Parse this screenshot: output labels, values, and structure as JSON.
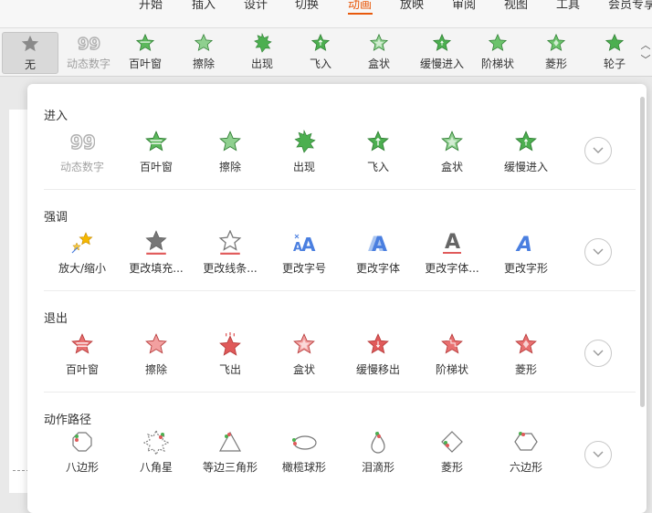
{
  "ribbon": {
    "tabs": [
      {
        "label": "开始"
      },
      {
        "label": "插入"
      },
      {
        "label": "设计"
      },
      {
        "label": "切换"
      },
      {
        "label": "动画"
      },
      {
        "label": "放映"
      },
      {
        "label": "审阅"
      },
      {
        "label": "视图"
      },
      {
        "label": "工具"
      },
      {
        "label": "会员专享"
      }
    ],
    "active_tab": "动画"
  },
  "strip": {
    "items": [
      {
        "label": "无",
        "icon": "star-gray-icon"
      },
      {
        "label": "动态数字",
        "icon": "digits-icon"
      },
      {
        "label": "百叶窗",
        "icon": "star-green-icon"
      },
      {
        "label": "擦除",
        "icon": "star-green-icon"
      },
      {
        "label": "出现",
        "icon": "star-green-icon"
      },
      {
        "label": "飞入",
        "icon": "star-green-icon"
      },
      {
        "label": "盒状",
        "icon": "star-green-icon"
      },
      {
        "label": "缓慢进入",
        "icon": "star-green-icon"
      },
      {
        "label": "阶梯状",
        "icon": "star-green-icon"
      },
      {
        "label": "菱形",
        "icon": "star-green-icon"
      },
      {
        "label": "轮子",
        "icon": "star-green-icon"
      }
    ]
  },
  "panel": {
    "sections": [
      {
        "title": "进入",
        "items": [
          {
            "label": "动态数字",
            "icon": "digits-icon"
          },
          {
            "label": "百叶窗",
            "icon": "star-green-blinds-icon"
          },
          {
            "label": "擦除",
            "icon": "star-green-wipe-icon"
          },
          {
            "label": "出现",
            "icon": "star-green-appear-icon"
          },
          {
            "label": "飞入",
            "icon": "star-green-fly-icon"
          },
          {
            "label": "盒状",
            "icon": "star-green-box-icon"
          },
          {
            "label": "缓慢进入",
            "icon": "star-green-slow-icon"
          }
        ]
      },
      {
        "title": "强调",
        "items": [
          {
            "label": "放大/缩小",
            "icon": "stars-grow-icon"
          },
          {
            "label": "更改填充...",
            "icon": "star-fill-icon"
          },
          {
            "label": "更改线条...",
            "icon": "star-outline-icon"
          },
          {
            "label": "更改字号",
            "icon": "font-size-icon"
          },
          {
            "label": "更改字体",
            "icon": "font-icon"
          },
          {
            "label": "更改字体...",
            "icon": "font-color-icon"
          },
          {
            "label": "更改字形",
            "icon": "font-style-icon"
          }
        ]
      },
      {
        "title": "退出",
        "items": [
          {
            "label": "百叶窗",
            "icon": "star-red-icon"
          },
          {
            "label": "擦除",
            "icon": "star-red-icon"
          },
          {
            "label": "飞出",
            "icon": "star-red-icon"
          },
          {
            "label": "盒状",
            "icon": "star-red-icon"
          },
          {
            "label": "缓慢移出",
            "icon": "star-red-icon"
          },
          {
            "label": "阶梯状",
            "icon": "star-red-icon"
          },
          {
            "label": "菱形",
            "icon": "star-red-icon"
          }
        ]
      },
      {
        "title": "动作路径",
        "items": [
          {
            "label": "八边形",
            "icon": "octagon-path-icon"
          },
          {
            "label": "八角星",
            "icon": "star8-path-icon"
          },
          {
            "label": "等边三角形",
            "icon": "triangle-path-icon"
          },
          {
            "label": "橄榄球形",
            "icon": "ellipse-path-icon"
          },
          {
            "label": "泪滴形",
            "icon": "teardrop-path-icon"
          },
          {
            "label": "菱形",
            "icon": "diamond-path-icon"
          },
          {
            "label": "六边形",
            "icon": "hexagon-path-icon"
          }
        ]
      }
    ]
  },
  "colors": {
    "accent": "#e8590c",
    "enter_green": "#4caf50",
    "exit_red": "#e05a5a",
    "emphasis_blue": "#4a7fe0"
  }
}
